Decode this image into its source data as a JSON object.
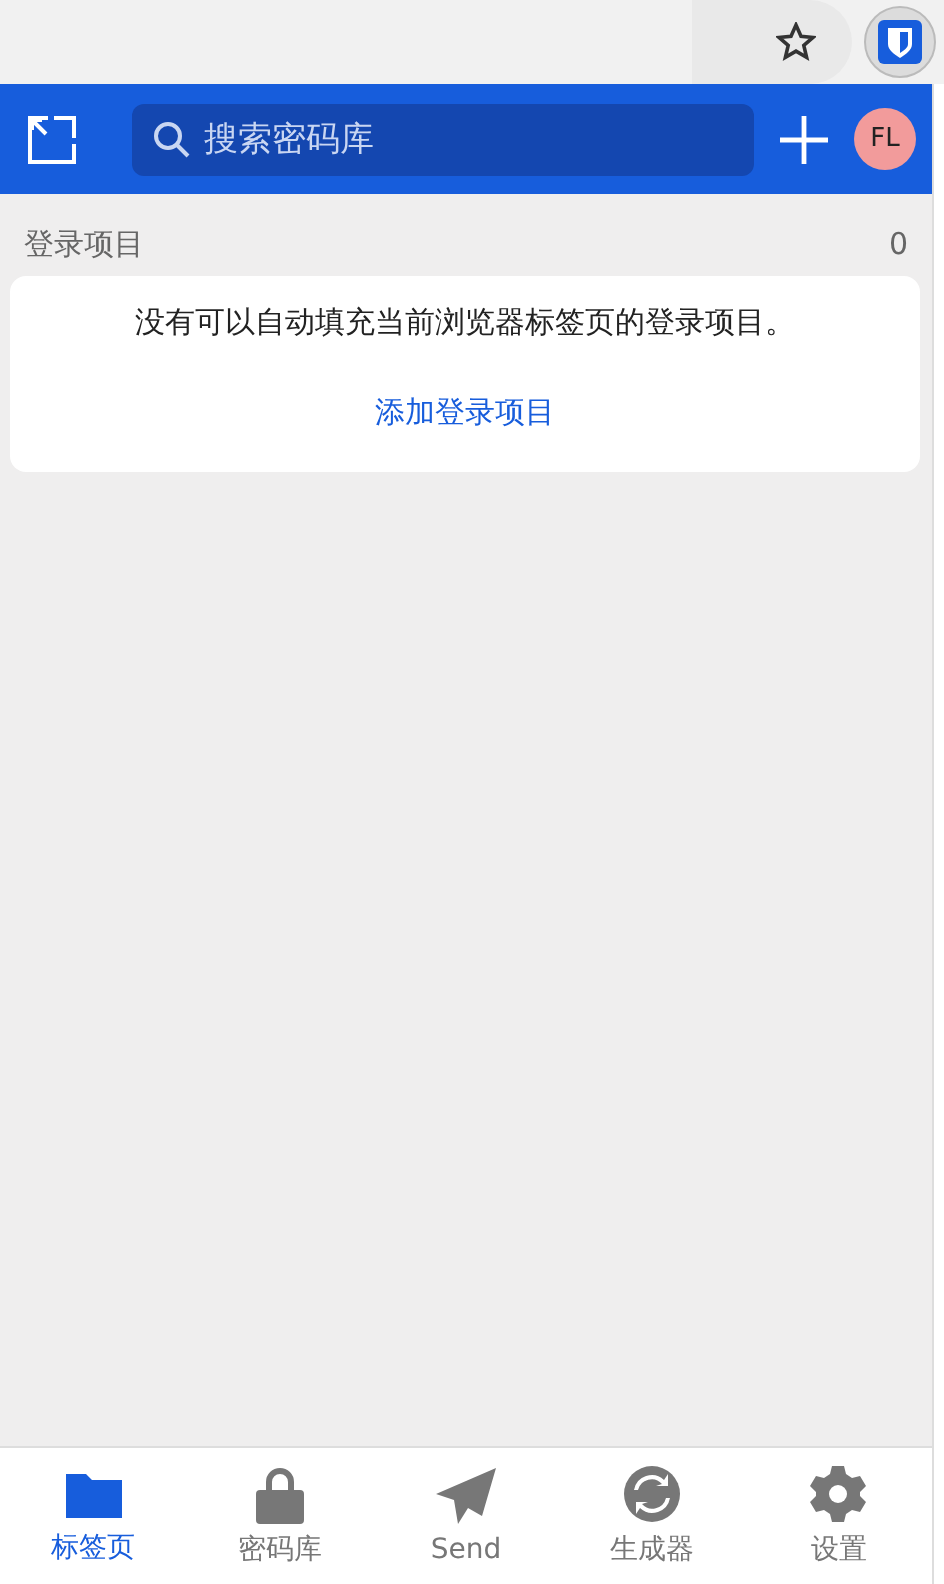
{
  "header": {
    "search": {
      "placeholder": "搜索密码库"
    },
    "avatar": "FL"
  },
  "section": {
    "title": "登录项目",
    "count": "0"
  },
  "empty": {
    "message": "没有可以自动填充当前浏览器标签页的登录项目。",
    "link": "添加登录项目"
  },
  "nav": [
    {
      "kind": "folder",
      "label": "标签页",
      "selected": true
    },
    {
      "kind": "lock",
      "label": "密码库",
      "selected": false
    },
    {
      "kind": "send",
      "label": "Send",
      "selected": false
    },
    {
      "kind": "generator",
      "label": "生成器",
      "selected": false
    },
    {
      "kind": "gear",
      "label": "设置",
      "selected": false
    }
  ]
}
